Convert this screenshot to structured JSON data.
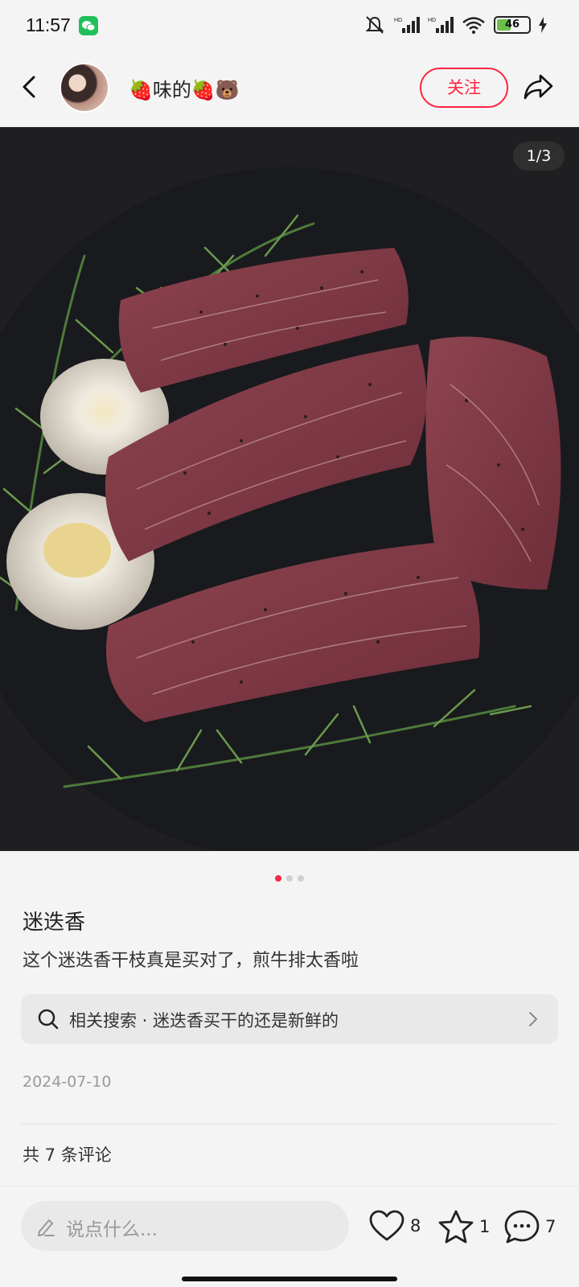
{
  "status_bar": {
    "time": "11:57",
    "battery_level": "46",
    "battery_fraction": 0.46
  },
  "header": {
    "author_name": "🍓味的🍓🐻",
    "follow_label": "关注"
  },
  "photo": {
    "page_indicator": "1/3",
    "total_images": 3,
    "current_index": 1
  },
  "note": {
    "title": "迷迭香",
    "body": "这个迷迭香干枝真是买对了，煎牛排太香啦",
    "related_search": "相关搜索 · 迷迭香买干的还是新鲜的",
    "date": "2024-07-10",
    "comment_count_text": "共 7 条评论"
  },
  "bottom_bar": {
    "comment_placeholder": "说点什么...",
    "likes": "8",
    "collects": "1",
    "comments": "7"
  },
  "colors": {
    "accent": "#ff2442",
    "background": "#f4f4f4"
  },
  "icons": [
    "wechat-icon",
    "mute-icon",
    "signal-icon",
    "wifi-icon",
    "battery-icon",
    "back-icon",
    "share-icon",
    "search-icon",
    "chevron-right-icon",
    "pen-icon",
    "heart-icon",
    "star-icon",
    "comment-icon"
  ]
}
